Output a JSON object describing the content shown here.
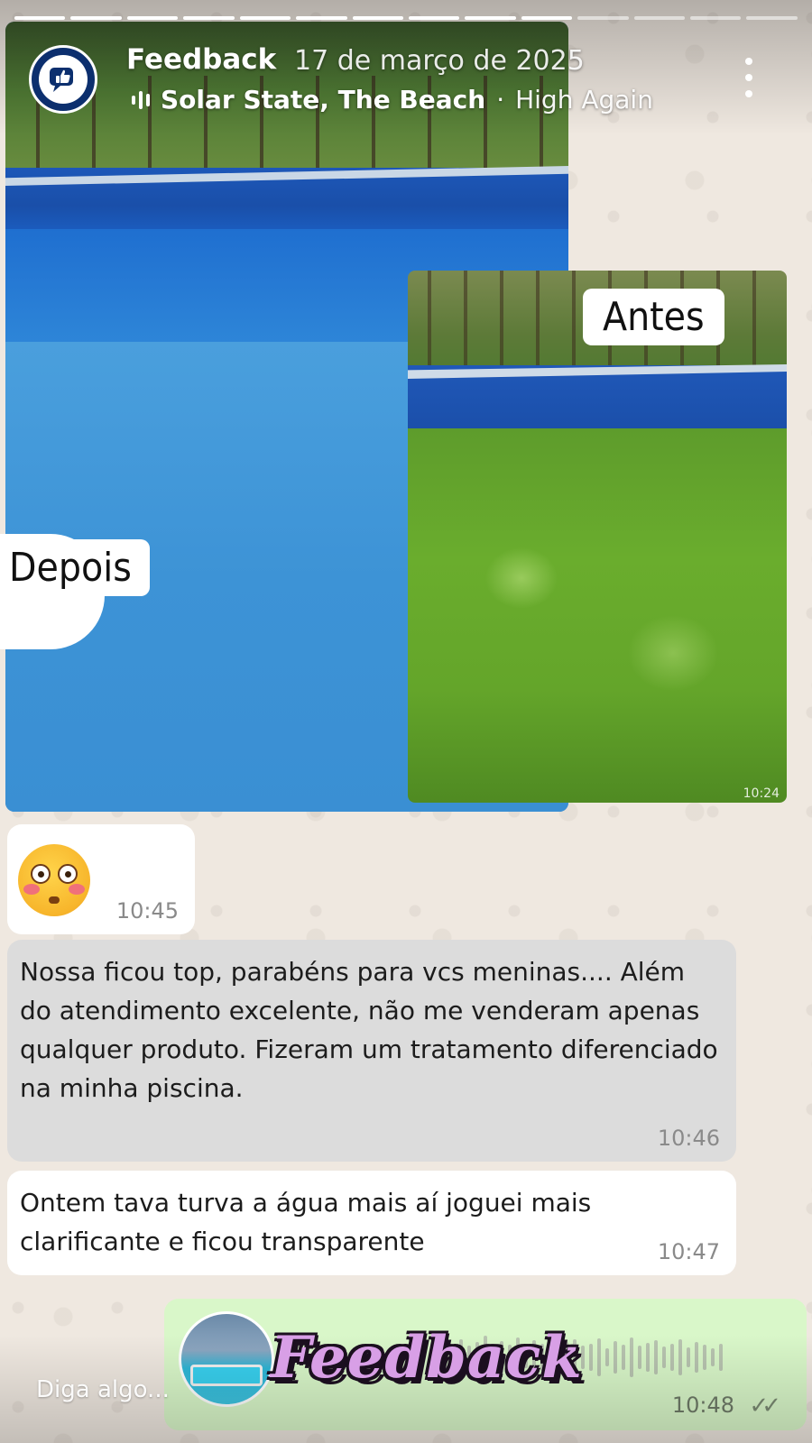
{
  "story": {
    "progress_segments": 14,
    "progress_done": 10
  },
  "header": {
    "title": "Feedback",
    "date": "17 de março de 2025",
    "song": "Solar State, The Beach",
    "artist_sep": "·",
    "artist": "High Again",
    "avatar_icon": "thumbs-up-chat-icon",
    "menu_icon": "more-vertical-icon"
  },
  "image_message": {
    "label_before": "Antes",
    "label_after": "Depois",
    "inner_time": "10:24"
  },
  "messages": [
    {
      "type": "emoji",
      "emoji": "flushed-face",
      "time": "10:45"
    },
    {
      "type": "text",
      "text": "Nossa ficou top, parabéns para vcs meninas.... Além do atendimento excelente, não me venderam apenas qualquer produto. Fizeram um tratamento diferenciado na minha piscina.",
      "time": "10:46"
    },
    {
      "type": "text",
      "text": "Ontem tava turva a água mais aí joguei mais clarificante e ficou transparente",
      "time": "10:47"
    },
    {
      "type": "audio",
      "time": "10:48",
      "status": "✓✓"
    }
  ],
  "sticker": {
    "text": "Feedback"
  },
  "reply": {
    "placeholder": "Diga algo..."
  },
  "colors": {
    "avatar_bg": "#0c2f6e",
    "sticker_fill": "#d89fe6",
    "audio_bubble": "#d9f7c9",
    "grey_bubble": "#dcdcdc"
  }
}
